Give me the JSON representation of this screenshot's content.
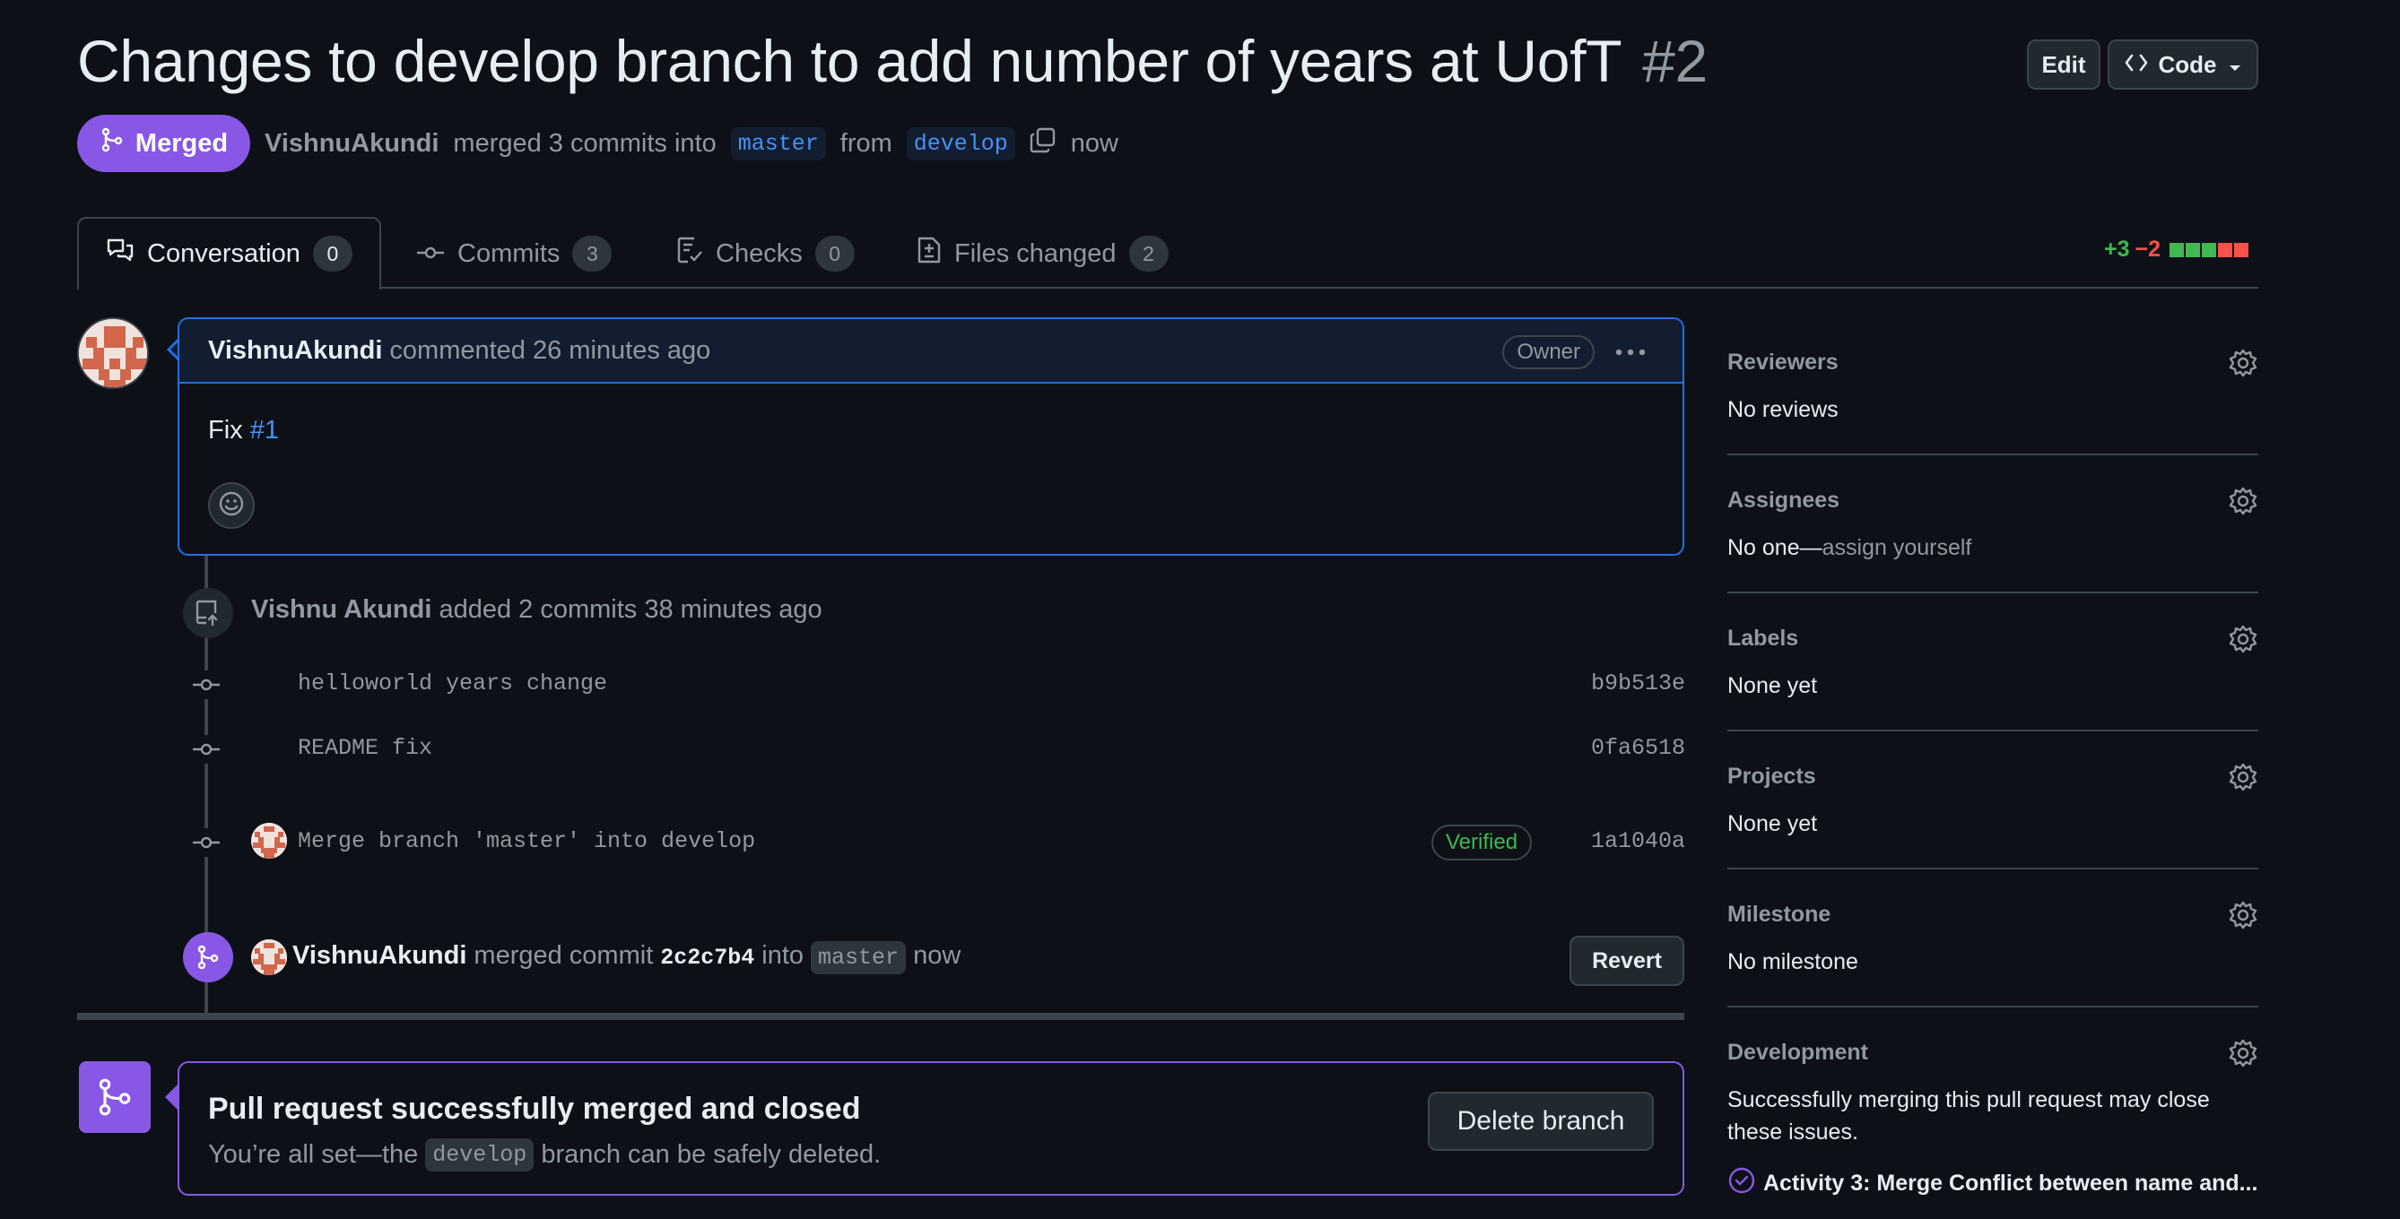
{
  "pr": {
    "title": "Changes to develop branch to add number of years at UofT",
    "number": "#2",
    "state": "Merged",
    "author": "VishnuAkundi",
    "merge_phrase": "merged 3 commits into",
    "base_branch": "master",
    "from_word": "from",
    "head_branch": "develop",
    "time": "now"
  },
  "header_buttons": {
    "edit": "Edit",
    "code": "Code"
  },
  "tabs": [
    {
      "label": "Conversation",
      "count": "0",
      "active": true,
      "icon": "comment-discussion-icon"
    },
    {
      "label": "Commits",
      "count": "3",
      "icon": "commit-icon"
    },
    {
      "label": "Checks",
      "count": "0",
      "icon": "checklist-icon"
    },
    {
      "label": "Files changed",
      "count": "2",
      "icon": "file-diff-icon"
    }
  ],
  "diffstat": {
    "additions": "+3",
    "deletions": "−2"
  },
  "comment": {
    "author": "VishnuAkundi",
    "action": "commented 26 minutes ago",
    "badge": "Owner",
    "body_prefix": "Fix",
    "body_link": "#1"
  },
  "commits_event": {
    "author": "Vishnu Akundi",
    "text": "added 2 commits 38 minutes ago"
  },
  "commits": [
    {
      "message": "helloworld years change",
      "sha": "b9b513e"
    },
    {
      "message": "README fix",
      "sha": "0fa6518"
    },
    {
      "message": "Merge branch 'master' into develop",
      "sha": "1a1040a",
      "verified": "Verified"
    }
  ],
  "merge_event": {
    "author": "VishnuAkundi",
    "action": "merged commit",
    "sha": "2c2c7b4",
    "into": "into",
    "branch": "master",
    "time": "now",
    "revert": "Revert"
  },
  "merged_box": {
    "title": "Pull request successfully merged and closed",
    "sub_prefix": "You’re all set—the",
    "branch": "develop",
    "sub_suffix": "branch can be safely deleted.",
    "delete_button": "Delete branch"
  },
  "sidebar": {
    "reviewers": {
      "heading": "Reviewers",
      "value": "No reviews"
    },
    "assignees": {
      "heading": "Assignees",
      "value": "No one—",
      "link": "assign yourself"
    },
    "labels": {
      "heading": "Labels",
      "value": "None yet"
    },
    "projects": {
      "heading": "Projects",
      "value": "None yet"
    },
    "milestone": {
      "heading": "Milestone",
      "value": "No milestone"
    },
    "development": {
      "heading": "Development",
      "value": "Successfully merging this pull request may close these issues.",
      "issue": "Activity 3: Merge Conflict between name and..."
    }
  },
  "colors": {
    "merged": "#8957e5",
    "link": "#4493f8",
    "success": "#3fb950",
    "danger": "#f85149",
    "bg": "#0d1117"
  }
}
